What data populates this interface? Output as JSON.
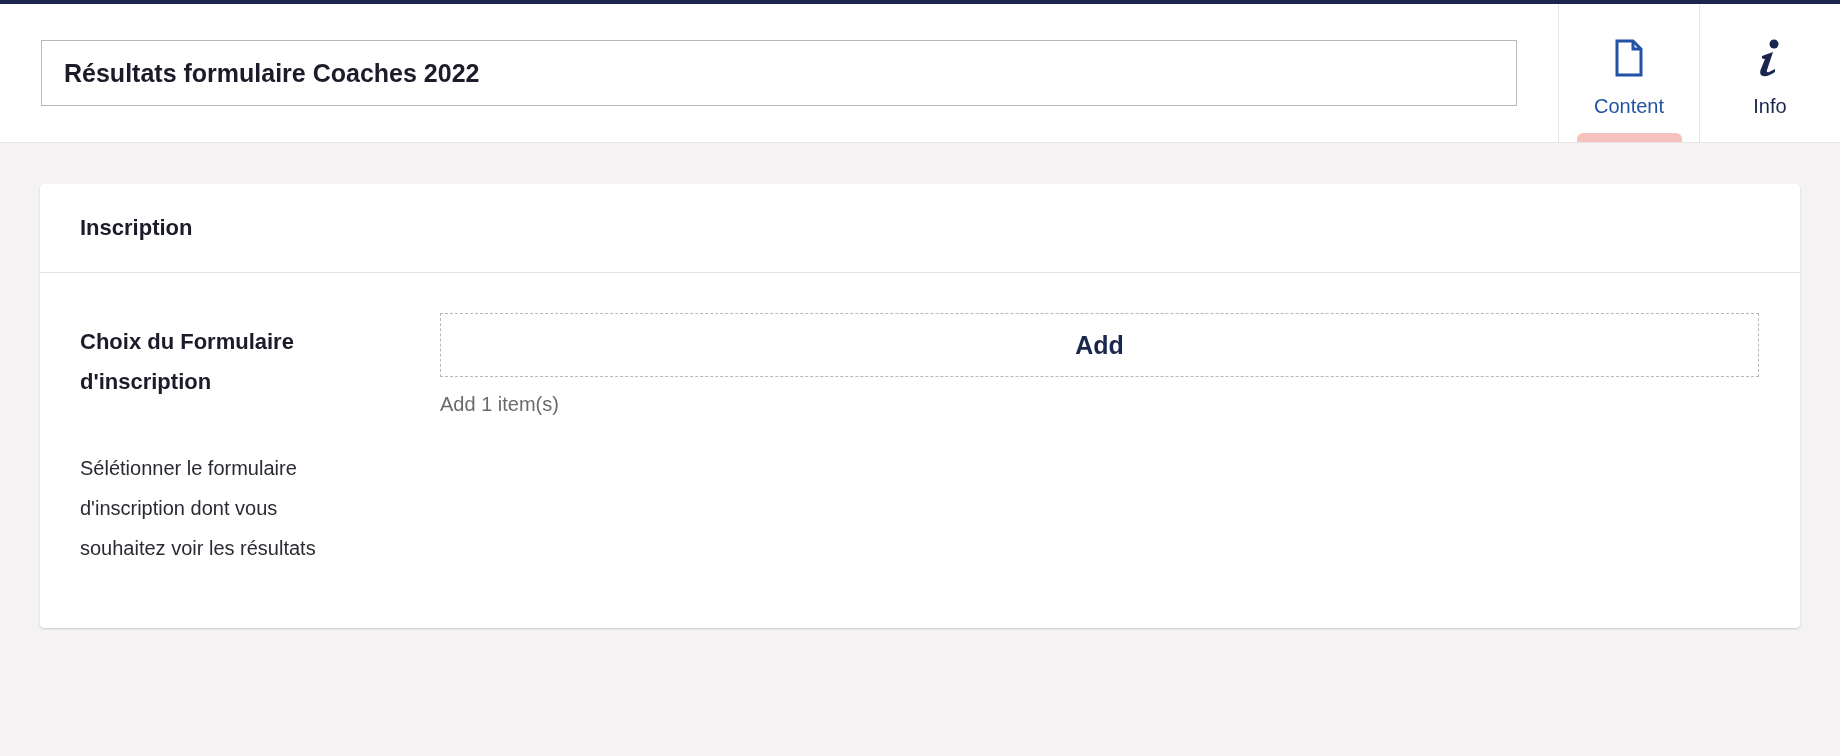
{
  "header": {
    "title_field": {
      "value": "Résultats formulaire Coaches 2022"
    },
    "tabs": [
      {
        "label": "Content",
        "kind": "document",
        "selected": true
      },
      {
        "label": "Info",
        "kind": "info",
        "selected": false
      }
    ]
  },
  "card": {
    "title": "Inscription",
    "properties": [
      {
        "label": "Choix du Formulaire d'inscription",
        "description": "Sélétionner le formulaire d'inscription dont vous souhaitez voir les résultats",
        "button": "Add",
        "hint": "Add 1 item(s)"
      }
    ]
  }
}
